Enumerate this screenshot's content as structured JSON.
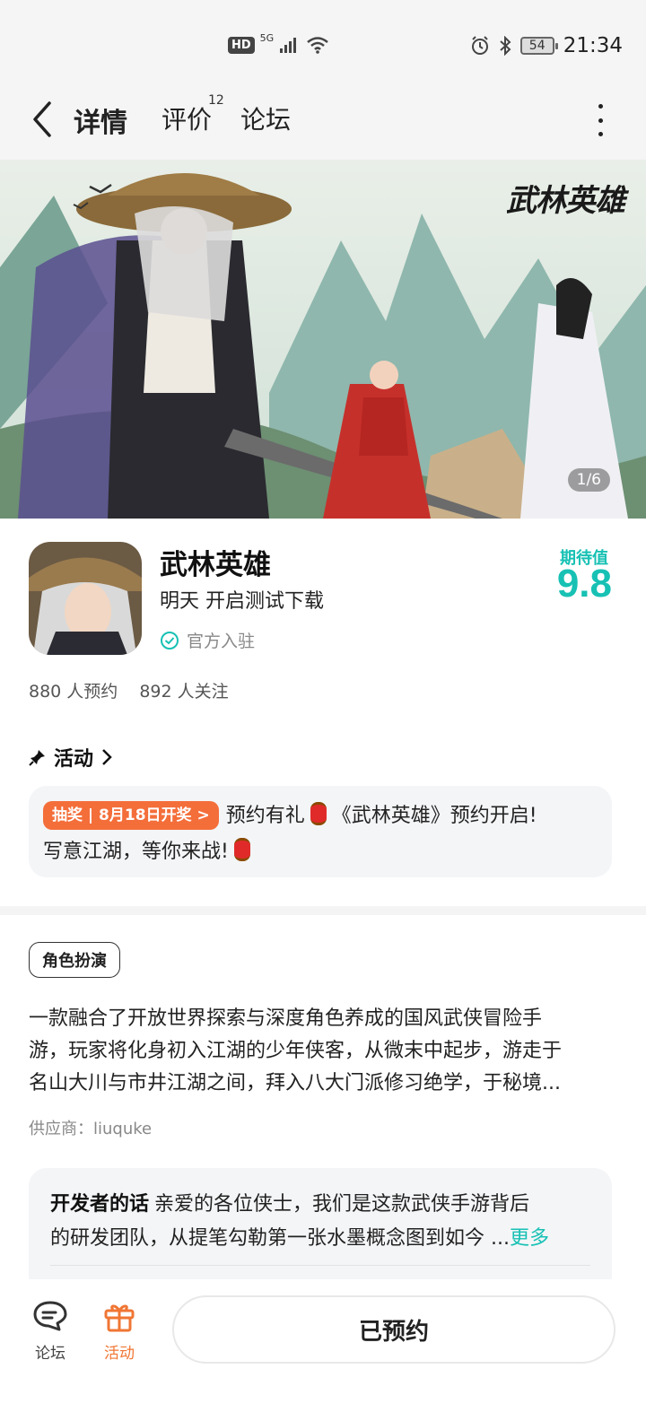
{
  "status_bar": {
    "hd": "HD",
    "network": "5G",
    "battery": "54",
    "time": "21:34"
  },
  "nav": {
    "tabs": [
      {
        "label": "详情"
      },
      {
        "label": "评价",
        "count": "12"
      },
      {
        "label": "论坛"
      }
    ]
  },
  "banner": {
    "title": "武林英雄",
    "counter": "1/6"
  },
  "app": {
    "name": "武林英雄",
    "status": "明天 开启测试下载",
    "official": "官方入驻",
    "expect_label": "期待值",
    "expect_score": "9.8",
    "reservations": "880 人预约",
    "followers": "892 人关注"
  },
  "activity": {
    "header": "活动",
    "pill": "抽奖 | 8月18日开奖 >",
    "text_a": "预约有礼",
    "text_b": "《武林英雄》预约开启!",
    "text_c": "写意江湖，等你来战!"
  },
  "description": {
    "tag": "角色扮演",
    "lines": [
      "一款融合了开放世界探索与深度角色养成的国风武侠冒险手",
      "游，玩家将化身初入江湖的少年侠客，从微末中起步，游走于",
      "名山大川与市井江湖之间，拜入八大门派修习绝学，于秘境..."
    ],
    "supplier": "供应商：liuquke"
  },
  "developer": {
    "label": "开发者的话",
    "line1": "亲爱的各位侠士，我们是这款武侠手游背后",
    "line2": "的研发团队，从提笔勾勒第一张水墨概念图到如今 ...",
    "more": "更多"
  },
  "bottom": {
    "forum": "论坛",
    "activity": "活动",
    "reserve": "已预约"
  },
  "colors": {
    "accent": "#17c1b4",
    "highlight": "#1ed3c6",
    "orange": "#f07634",
    "pill": "#f46e3a"
  }
}
